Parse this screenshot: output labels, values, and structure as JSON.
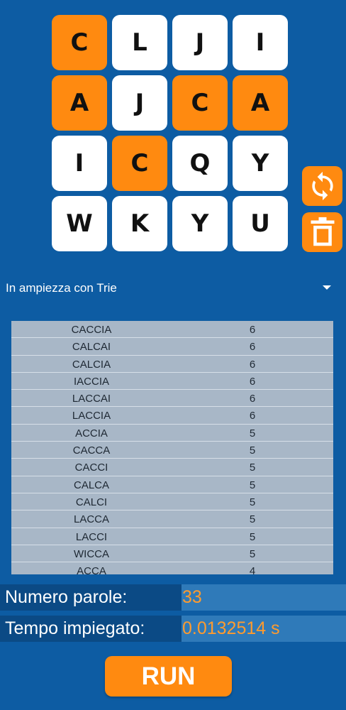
{
  "colors": {
    "background": "#0d5ca3",
    "accent": "#ff8a10",
    "tile": "#ffffff"
  },
  "grid": {
    "tiles": [
      {
        "letter": "C",
        "selected": true
      },
      {
        "letter": "L",
        "selected": false
      },
      {
        "letter": "J",
        "selected": false
      },
      {
        "letter": "I",
        "selected": false
      },
      {
        "letter": "A",
        "selected": true
      },
      {
        "letter": "J",
        "selected": false
      },
      {
        "letter": "C",
        "selected": true
      },
      {
        "letter": "A",
        "selected": true
      },
      {
        "letter": "I",
        "selected": false
      },
      {
        "letter": "C",
        "selected": true
      },
      {
        "letter": "Q",
        "selected": false
      },
      {
        "letter": "Y",
        "selected": false
      },
      {
        "letter": "W",
        "selected": false
      },
      {
        "letter": "K",
        "selected": false
      },
      {
        "letter": "Y",
        "selected": false
      },
      {
        "letter": "U",
        "selected": false
      }
    ]
  },
  "side_buttons": {
    "refresh_icon": "refresh-icon",
    "delete_icon": "trash-icon"
  },
  "algorithm": {
    "selected": "In ampiezza con Trie"
  },
  "results": [
    {
      "word": "CACCIA",
      "len": "6"
    },
    {
      "word": "CALCAI",
      "len": "6"
    },
    {
      "word": "CALCIA",
      "len": "6"
    },
    {
      "word": "IACCIA",
      "len": "6"
    },
    {
      "word": "LACCAI",
      "len": "6"
    },
    {
      "word": "LACCIA",
      "len": "6"
    },
    {
      "word": "ACCIA",
      "len": "5"
    },
    {
      "word": "CACCA",
      "len": "5"
    },
    {
      "word": "CACCI",
      "len": "5"
    },
    {
      "word": "CALCA",
      "len": "5"
    },
    {
      "word": "CALCI",
      "len": "5"
    },
    {
      "word": "LACCA",
      "len": "5"
    },
    {
      "word": "LACCI",
      "len": "5"
    },
    {
      "word": "WICCA",
      "len": "5"
    },
    {
      "word": "ACCA",
      "len": "4"
    }
  ],
  "stats": {
    "words_label": "Numero parole:",
    "words_value": "33",
    "time_label": "Tempo impiegato:",
    "time_value": "0.0132514 s"
  },
  "run_label": "RUN"
}
